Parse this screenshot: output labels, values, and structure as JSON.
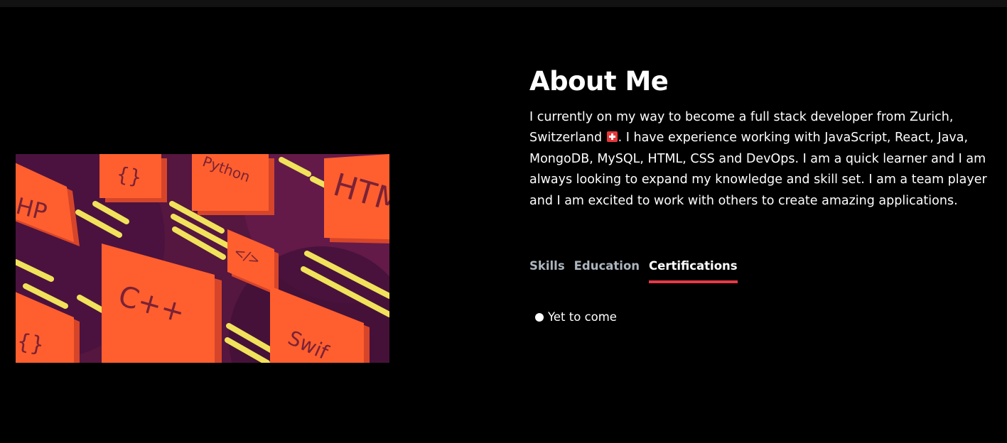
{
  "about": {
    "title": "About Me",
    "bio_before_flag": "I currently on my way to become a full stack developer from Zurich, Switzerland ",
    "bio_after_flag": ". I have experience working with JavaScript, React, Java, MongoDB, MySQL, HTML, CSS and DevOps. I am a quick learner and I am always looking to expand my knowledge and skill set. I am a team player and I am excited to work with others to create amazing applications.",
    "flag_icon": "swiss-flag-icon"
  },
  "image": {
    "labels": {
      "php": "HP",
      "braces_top": "{}",
      "python": "Python",
      "html": "HTM",
      "code": "</>",
      "cpp": "C++",
      "braces_bottom": "{}",
      "swift": "Swif"
    },
    "colors": {
      "background": "#5a1846",
      "block": "#ff5f2e",
      "block_side": "#d6452a",
      "block_text": "#7a2236",
      "stripe": "#f1e25b"
    }
  },
  "tabs": [
    {
      "label": "Skills",
      "active": false
    },
    {
      "label": "Education",
      "active": false
    },
    {
      "label": "Certifications",
      "active": true
    }
  ],
  "certifications": {
    "items": [
      "Yet to come"
    ]
  },
  "colors": {
    "background": "#000000",
    "text": "#ffffff",
    "tab_inactive": "#adb5bd",
    "accent": "#e63946"
  }
}
